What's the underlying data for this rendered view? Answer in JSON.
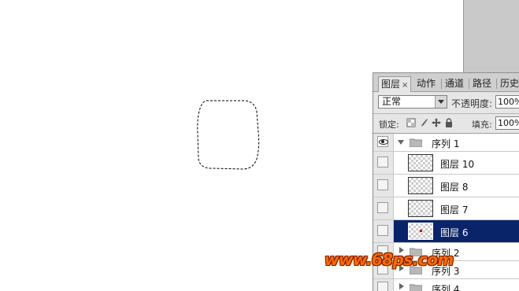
{
  "layers_panel": {
    "tabs": [
      {
        "label": "图层",
        "close": "×",
        "active": true
      },
      {
        "label": "动作",
        "active": false
      },
      {
        "label": "通道",
        "active": false
      },
      {
        "label": "路径",
        "active": false
      },
      {
        "label": "历史",
        "active": false
      }
    ],
    "blend_mode": "正常",
    "opacity_label": "不透明度:",
    "opacity_value": "100%",
    "lock_label": "锁定:",
    "fill_label": "填充:",
    "fill_value": "100%",
    "rows": [
      {
        "kind": "group",
        "name": "序列 1",
        "expanded": true,
        "visible": true
      },
      {
        "kind": "layer",
        "name": "图层 10",
        "selected": false,
        "visible": false
      },
      {
        "kind": "layer",
        "name": "图层 8",
        "selected": false,
        "visible": false
      },
      {
        "kind": "layer",
        "name": "图层 7",
        "selected": false,
        "visible": false
      },
      {
        "kind": "layer",
        "name": "图层 6",
        "selected": true,
        "visible": false
      },
      {
        "kind": "group",
        "name": "序列 2",
        "expanded": false,
        "visible": false
      },
      {
        "kind": "group",
        "name": "序列 3",
        "expanded": false,
        "visible": false
      },
      {
        "kind": "group",
        "name": "序列 4",
        "expanded": false,
        "visible": false
      }
    ]
  },
  "icons": {
    "eye": "eye-icon",
    "folder": "folder-icon",
    "lock_transparent": "lock-transparent-pixels-icon",
    "lock_paint": "brush-icon",
    "lock_move": "move-icon",
    "lock_all": "lock-icon"
  },
  "watermark": "www.68ps.com",
  "colors": {
    "selection_highlight": "#0a246a",
    "watermark": "#ff6a00"
  }
}
